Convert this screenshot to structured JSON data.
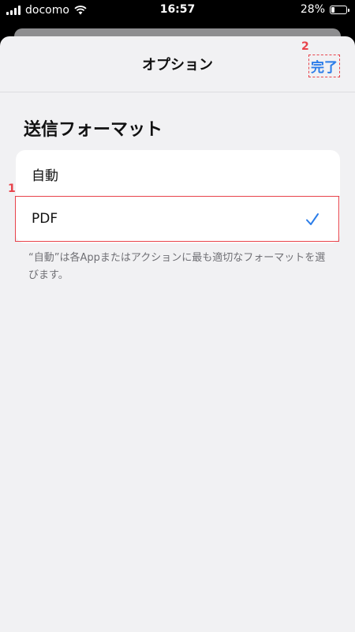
{
  "status_bar": {
    "carrier": "docomo",
    "time": "16:57",
    "battery_percent": "28%",
    "battery_level": 0.28
  },
  "nav": {
    "title": "オプション",
    "done_label": "完了"
  },
  "annotations": {
    "badge_1": "1",
    "badge_2": "2"
  },
  "section": {
    "title": "送信フォーマット"
  },
  "options": {
    "auto_label": "自動",
    "pdf_label": "PDF",
    "selected": "PDF"
  },
  "footnote": "“自動”は各Appまたはアクションに最も適切なフォーマットを選びます。",
  "colors": {
    "accent": "#2b7de9",
    "annotation": "#e8434b",
    "sheet_bg": "#f1f1f3"
  }
}
